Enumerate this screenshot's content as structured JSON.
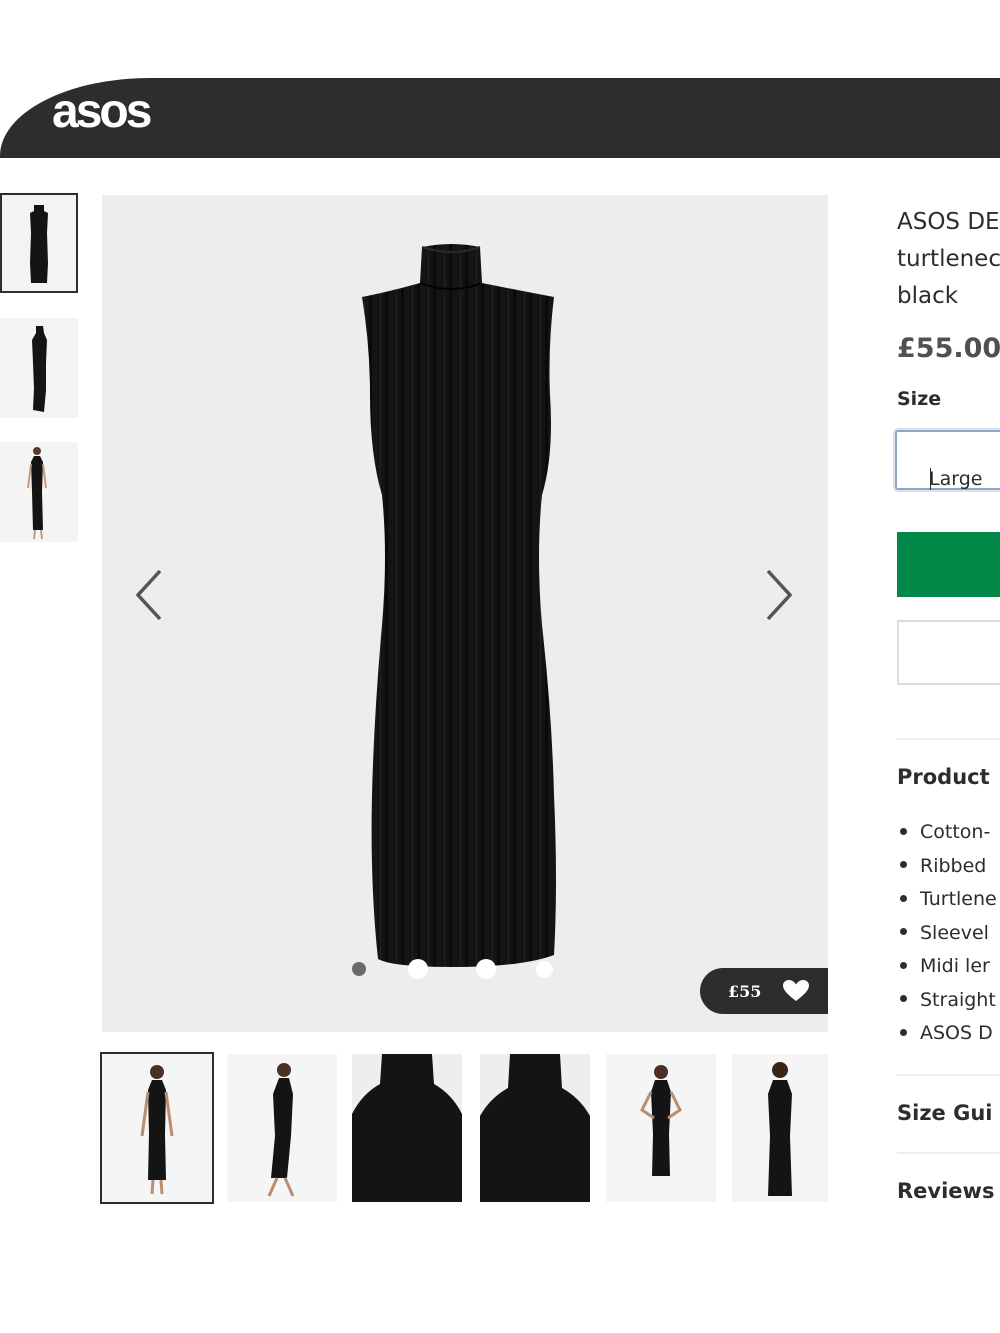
{
  "header": {
    "logo": "asos"
  },
  "gallery": {
    "side_thumbnails": [
      "front",
      "side",
      "model"
    ],
    "bottom_thumbnails": [
      "model front",
      "model side",
      "neck detail",
      "neck detail",
      "model pose",
      "model back"
    ],
    "selected_side_index": 0,
    "selected_bottom_index": 0,
    "dots_count": 4,
    "active_dot_index": 0,
    "price_tag": "£55"
  },
  "product": {
    "title_lines": [
      "ASOS DE",
      "turtlenec",
      "black"
    ],
    "price": "£55.00",
    "size_label": "Size",
    "size_value": "Large",
    "details_heading": "Product",
    "details": [
      "Cotton-",
      "Ribbed",
      "Turtlene",
      "Sleevel",
      "Midi ler",
      "Straight",
      "ASOS D"
    ],
    "size_guide_link": "Size Gui",
    "reviews_link": "Reviews"
  },
  "colors": {
    "header_bg": "#2d2d2d",
    "accent_green": "#018849",
    "image_bg": "#ededed",
    "dress": "#141414"
  },
  "icons": {
    "prev": "chevron-left-icon",
    "next": "chevron-right-icon",
    "heart": "heart-icon"
  }
}
